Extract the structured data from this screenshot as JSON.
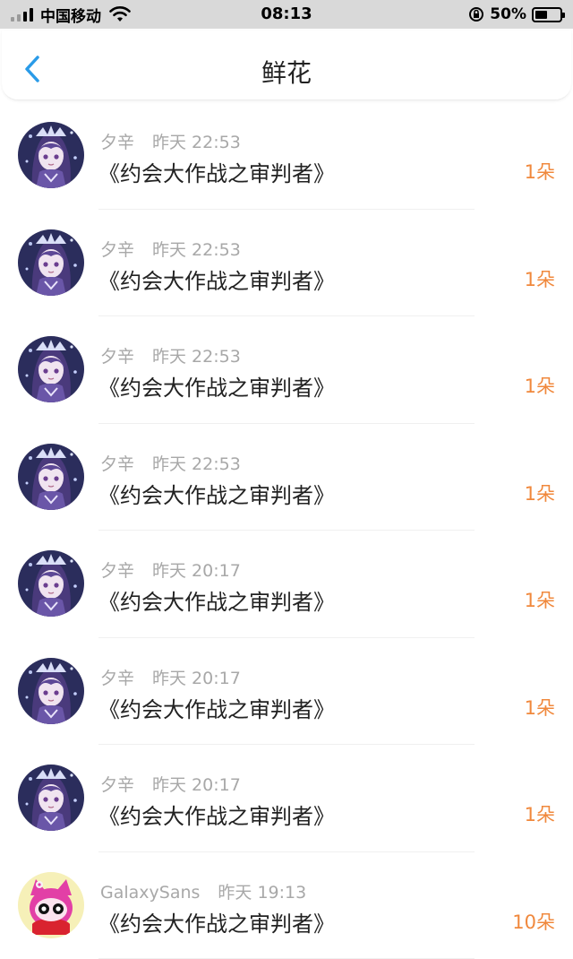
{
  "status_bar": {
    "carrier": "中国移动",
    "time": "08:13",
    "battery": "50%",
    "battery_level": 0.5
  },
  "nav": {
    "title": "鲜花",
    "back_icon": "chevron-left-icon"
  },
  "colors": {
    "accent_blue": "#2a9be8",
    "count_orange": "#f0883c",
    "meta_gray": "#a8a8a8"
  },
  "rows": [
    {
      "name": "夕辛",
      "time": "昨天 22:53",
      "title": "《约会大作战之审判者》",
      "count": "1朵",
      "avatar": "anime-avatar"
    },
    {
      "name": "夕辛",
      "time": "昨天 22:53",
      "title": "《约会大作战之审判者》",
      "count": "1朵",
      "avatar": "anime-avatar"
    },
    {
      "name": "夕辛",
      "time": "昨天 22:53",
      "title": "《约会大作战之审判者》",
      "count": "1朵",
      "avatar": "anime-avatar"
    },
    {
      "name": "夕辛",
      "time": "昨天 22:53",
      "title": "《约会大作战之审判者》",
      "count": "1朵",
      "avatar": "anime-avatar"
    },
    {
      "name": "夕辛",
      "time": "昨天 20:17",
      "title": "《约会大作战之审判者》",
      "count": "1朵",
      "avatar": "anime-avatar"
    },
    {
      "name": "夕辛",
      "time": "昨天 20:17",
      "title": "《约会大作战之审判者》",
      "count": "1朵",
      "avatar": "anime-avatar"
    },
    {
      "name": "夕辛",
      "time": "昨天 20:17",
      "title": "《约会大作战之审判者》",
      "count": "1朵",
      "avatar": "anime-avatar"
    },
    {
      "name": "GalaxySans",
      "time": "昨天 19:13",
      "title": "《约会大作战之审判者》",
      "count": "10朵",
      "avatar": "cartoon-cat-avatar"
    }
  ]
}
